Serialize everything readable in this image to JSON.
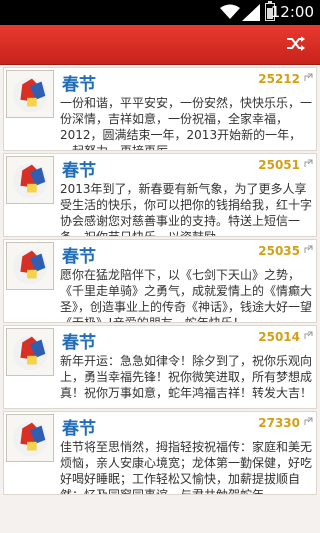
{
  "status_bar": {
    "time": "12:00"
  },
  "colors": {
    "toolbar": "#d42d24",
    "title": "#1f6db8",
    "count": "#d4a017"
  },
  "items": [
    {
      "title": "春节",
      "count": "25212",
      "text": "一份和谐，平平安安，一份安然，快快乐乐，一份深情，吉祥如意，一份祝福，全家幸福，2012，圆满结束一年，2013开始新的一年，一起努力，再接再厉。"
    },
    {
      "title": "春节",
      "count": "25051",
      "text": "2013年到了，新春要有新气象，为了更多人享受生活的快乐，你可以把你的钱捐给我，红十字协会感谢您对慈善事业的支持。特送上短信一条，祝你节日快乐，以资鼓励。"
    },
    {
      "title": "春节",
      "count": "25035",
      "text": "愿你在猛龙陪伴下，以《七剑下天山》之势，《千里走单骑》之勇气，成就爱情上的《情癫大圣》，创造事业上的传奇《神话》，钱途大好一望《无极》!亲爱的朋友，蛇年快乐！"
    },
    {
      "title": "春节",
      "count": "25014",
      "text": "新年开运：急急如律令！除夕到了，祝你乐观向上，勇当幸福先锋！祝你微笑进取，所有梦想成真！祝你万事如意，蛇年鸿福吉祥！转发大吉！"
    },
    {
      "title": "春节",
      "count": "27330",
      "text": "佳节将至思悄然，拇指轻按祝福传：家庭和美无烦恼，亲人安康心境宽；龙体第一勤保健，好吃好喝好睡眠；工作轻松又愉快，加薪提拔顺自然；忆及同窗同事谊，与君共勉贺蛇年。"
    }
  ]
}
